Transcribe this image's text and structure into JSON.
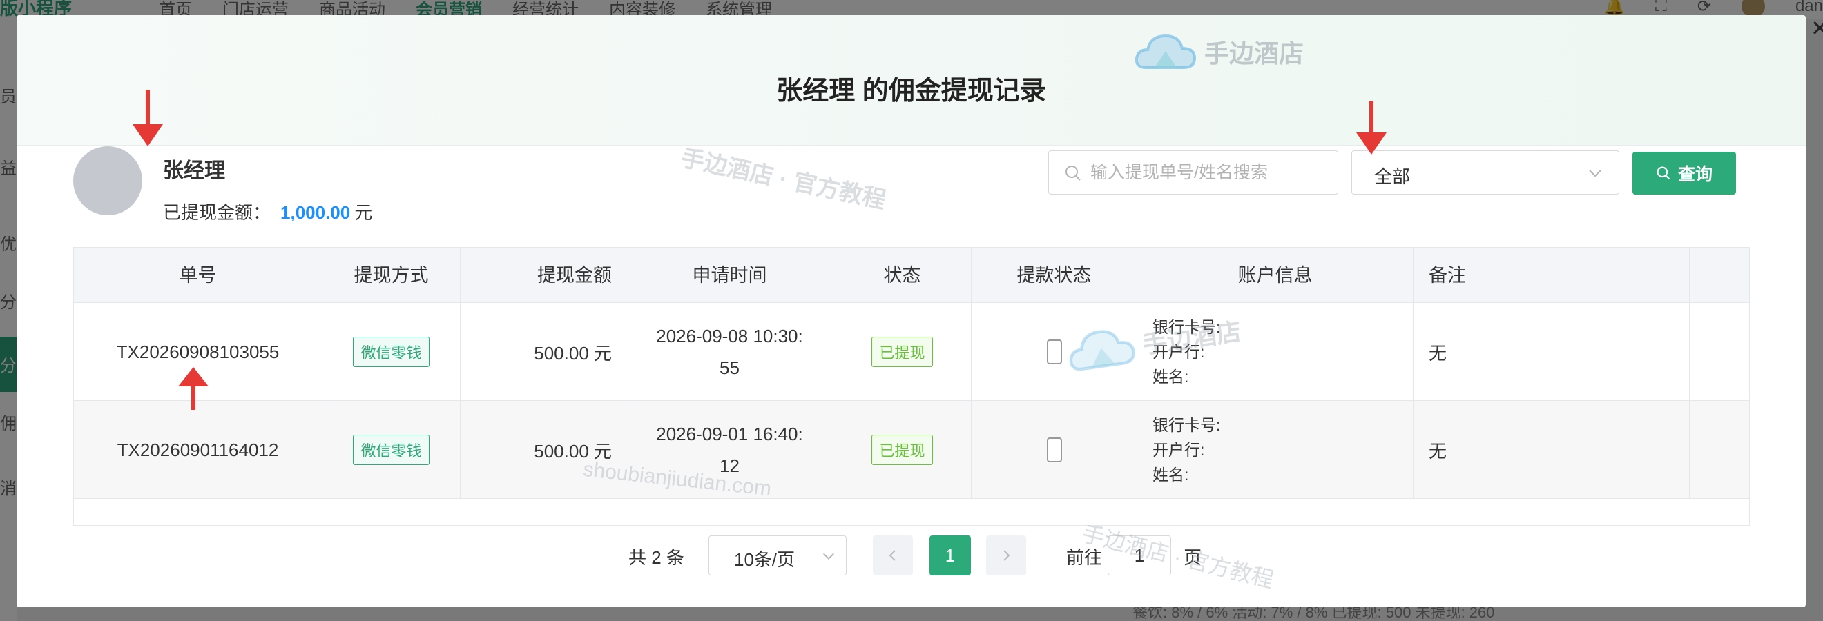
{
  "background": {
    "brand": "版小程序",
    "nav": [
      "首页",
      "门店运营",
      "商品活动",
      "会员营销",
      "经营统计",
      "内容装修",
      "系统管理"
    ],
    "active_nav": "会员营销",
    "user": "dan",
    "side_items": [
      "员",
      "益",
      "优",
      "分",
      "分",
      "佣",
      "消"
    ],
    "bottom_text": "餐饮: 8% / 6%   活动: 7% / 8%   已提现: 500   未提现: 260"
  },
  "dialog": {
    "title": "张经理 的佣金提现记录",
    "user_name": "张经理",
    "withdrawn_label": "已提现金额：",
    "withdrawn_amount": "1,000.00",
    "withdrawn_unit": "元",
    "search_placeholder": "输入提现单号/姓名搜索",
    "status_filter": "全部",
    "query_button": "查询"
  },
  "table": {
    "headers": [
      "单号",
      "提现方式",
      "提现金额",
      "申请时间",
      "状态",
      "提款状态",
      "账户信息",
      "备注"
    ],
    "rows": [
      {
        "id": "TX20260908103055",
        "method": "微信零钱",
        "amount": "500.00 元",
        "time_line1": "2026-09-08 10:30:",
        "time_line2": "55",
        "status": "已提现",
        "bank_card": "银行卡号:",
        "bank": "开户行:",
        "holder": "姓名:",
        "remark": "无"
      },
      {
        "id": "TX20260901164012",
        "method": "微信零钱",
        "amount": "500.00 元",
        "time_line1": "2026-09-01 16:40:",
        "time_line2": "12",
        "status": "已提现",
        "bank_card": "银行卡号:",
        "bank": "开户行:",
        "holder": "姓名:",
        "remark": "无"
      }
    ]
  },
  "pagination": {
    "total": "共 2 条",
    "page_size": "10条/页",
    "current": "1",
    "goto_label": "前往",
    "goto_value": "1",
    "page_word": "页"
  },
  "watermarks": {
    "logo_text": "手边酒店",
    "tutorial": "手边酒店 · 官方教程",
    "domain": "shoubianjiudian.com",
    "tutorial2": "手边酒店 · 官方教程"
  },
  "colors": {
    "accent": "#2daa7a",
    "amount_blue": "#1890ff",
    "status_green": "#67c23a",
    "annotation_red": "#e53935"
  }
}
